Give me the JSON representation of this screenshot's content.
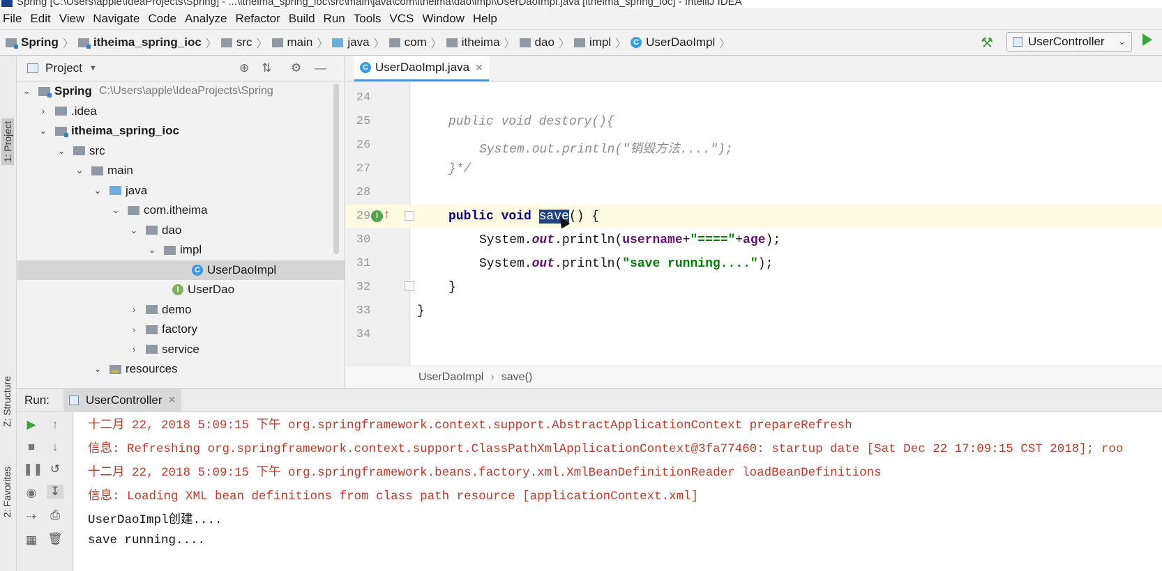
{
  "window": {
    "title": "Spring [C:\\Users\\apple\\IdeaProjects\\Spring] - ...\\itheima_spring_ioc\\src\\main\\java\\com\\itheima\\dao\\impl\\UserDaoImpl.java [itheima_spring_ioc] - IntelliJ IDEA"
  },
  "menu": [
    "File",
    "Edit",
    "View",
    "Navigate",
    "Code",
    "Analyze",
    "Refactor",
    "Build",
    "Run",
    "Tools",
    "VCS",
    "Window",
    "Help"
  ],
  "breadcrumb": [
    "Spring",
    "itheima_spring_ioc",
    "src",
    "main",
    "java",
    "com",
    "itheima",
    "dao",
    "impl",
    "UserDaoImpl"
  ],
  "toolbar": {
    "run_config": "UserController",
    "build_icon": "hammer-icon",
    "run_icon": "play-icon"
  },
  "side_tabs": {
    "project": "1: Project",
    "structure": "Z: Structure",
    "favorites": "2: Favorites"
  },
  "project_panel": {
    "title": "Project",
    "tree": [
      {
        "label": "Spring",
        "path": "C:\\Users\\apple\\IdeaProjects\\Spring",
        "depth": 0,
        "arrow": "down",
        "icon": "module-folder",
        "bold": true
      },
      {
        "label": ".idea",
        "depth": 1,
        "arrow": "right",
        "icon": "folder"
      },
      {
        "label": "itheima_spring_ioc",
        "depth": 1,
        "arrow": "down",
        "icon": "module-folder",
        "bold": true
      },
      {
        "label": "src",
        "depth": 2,
        "arrow": "down",
        "icon": "folder"
      },
      {
        "label": "main",
        "depth": 3,
        "arrow": "down",
        "icon": "folder"
      },
      {
        "label": "java",
        "depth": 4,
        "arrow": "down",
        "icon": "source-folder"
      },
      {
        "label": "com.itheima",
        "depth": 5,
        "arrow": "down",
        "icon": "package"
      },
      {
        "label": "dao",
        "depth": 6,
        "arrow": "down",
        "icon": "package"
      },
      {
        "label": "impl",
        "depth": 7,
        "arrow": "down",
        "icon": "package"
      },
      {
        "label": "UserDaoImpl",
        "depth": 8,
        "arrow": "none",
        "icon": "class",
        "selected": true
      },
      {
        "label": "UserDao",
        "depth": 7,
        "arrow": "none",
        "icon": "interface"
      },
      {
        "label": "demo",
        "depth": 6,
        "arrow": "right",
        "icon": "package"
      },
      {
        "label": "factory",
        "depth": 6,
        "arrow": "right",
        "icon": "package"
      },
      {
        "label": "service",
        "depth": 6,
        "arrow": "right",
        "icon": "package"
      },
      {
        "label": "resources",
        "depth": 4,
        "arrow": "down",
        "icon": "resources-folder"
      }
    ]
  },
  "editor": {
    "tab": "UserDaoImpl.java",
    "lines": [
      {
        "n": "24"
      },
      {
        "n": "25"
      },
      {
        "n": "26"
      },
      {
        "n": "27"
      },
      {
        "n": "28"
      },
      {
        "n": "29"
      },
      {
        "n": "30"
      },
      {
        "n": "31"
      },
      {
        "n": "32"
      },
      {
        "n": "33"
      },
      {
        "n": "34"
      }
    ],
    "code": {
      "l25": "public void destory(){",
      "l26": "System.out.println(\"销毁方法....\");",
      "l27": "}*/",
      "l29_kw": "public void ",
      "l29_sel": "save",
      "l29_rest": "() {",
      "l30_a": "System.",
      "l30_b": "out",
      "l30_c": ".println(",
      "l30_d": "username",
      "l30_e": "+",
      "l30_f": "\"====\"",
      "l30_g": "+",
      "l30_h": "age",
      "l30_i": ");",
      "l31_a": "System.",
      "l31_b": "out",
      "l31_c": ".println(",
      "l31_d": "\"save running....\"",
      "l31_e": ");",
      "l32": "}",
      "l33": "}"
    },
    "breadcrumb": [
      "UserDaoImpl",
      "save()"
    ]
  },
  "run_panel": {
    "label": "Run:",
    "tab": "UserController",
    "console": [
      {
        "text": "十二月 22, 2018 5:09:15 下午 org.springframework.context.support.AbstractApplicationContext prepareRefresh",
        "color": "#c0392b"
      },
      {
        "text": "信息: Refreshing org.springframework.context.support.ClassPathXmlApplicationContext@3fa77460: startup date [Sat Dec 22 17:09:15 CST 2018]; roo",
        "color": "#c0392b"
      },
      {
        "text": "十二月 22, 2018 5:09:15 下午 org.springframework.beans.factory.xml.XmlBeanDefinitionReader loadBeanDefinitions",
        "color": "#c0392b"
      },
      {
        "text": "信息: Loading XML bean definitions from class path resource [applicationContext.xml]",
        "color": "#c0392b"
      },
      {
        "text": "UserDaoImpl创建....",
        "color": "#111111"
      },
      {
        "text": "save running....",
        "color": "#111111"
      }
    ]
  }
}
